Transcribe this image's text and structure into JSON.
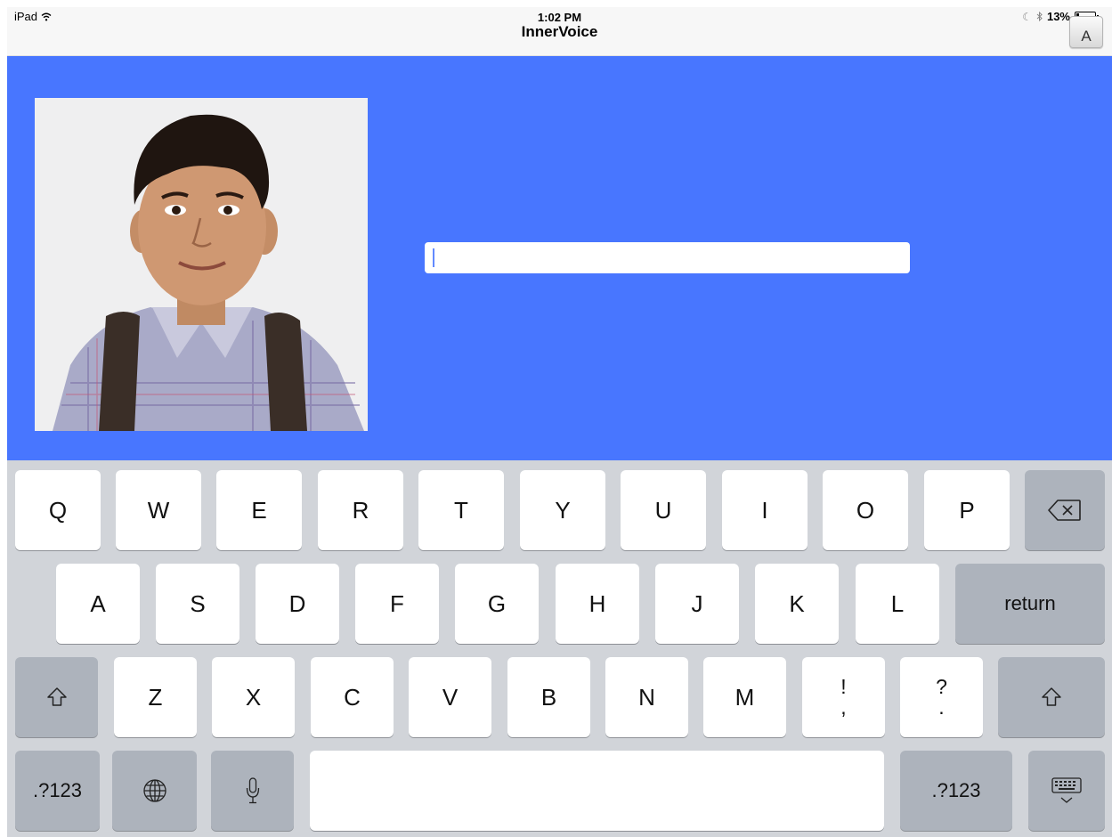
{
  "status_bar": {
    "carrier": "iPad",
    "time": "1:02 PM",
    "app_title": "InnerVoice",
    "battery_percent": "13%",
    "battery_level": 0.13,
    "font_key_label": "A"
  },
  "text_input": {
    "value": "",
    "placeholder": ""
  },
  "keyboard": {
    "row1": [
      "Q",
      "W",
      "E",
      "R",
      "T",
      "Y",
      "U",
      "I",
      "O",
      "P"
    ],
    "row2": [
      "A",
      "S",
      "D",
      "F",
      "G",
      "H",
      "J",
      "K",
      "L"
    ],
    "row3": [
      "Z",
      "X",
      "C",
      "V",
      "B",
      "N",
      "M"
    ],
    "punct1_top": "!",
    "punct1_bottom": ",",
    "punct2_top": "?",
    "punct2_bottom": ".",
    "return_label": "return",
    "numbers_label": ".?123"
  },
  "colors": {
    "content_bg": "#4876ff",
    "keyboard_bg": "#d1d4d9"
  },
  "icons": [
    "wifi-icon",
    "moon-icon",
    "bluetooth-icon",
    "battery-icon",
    "backspace-icon",
    "shift-icon",
    "globe-icon",
    "microphone-icon",
    "hide-keyboard-icon"
  ]
}
